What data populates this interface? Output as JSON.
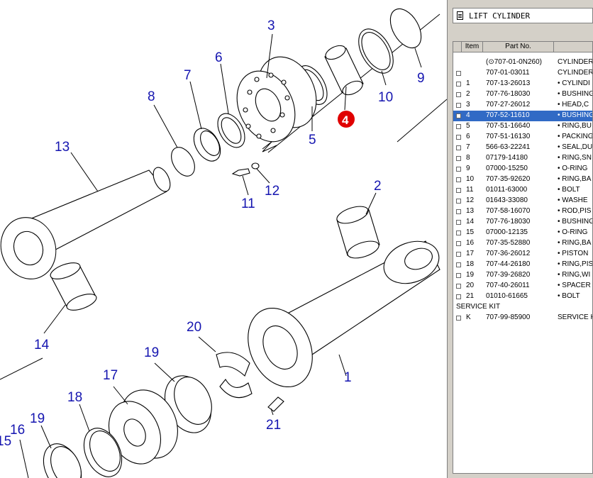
{
  "window": {
    "title": "LIFT CYLINDER"
  },
  "diagram": {
    "callouts": [
      "1",
      "2",
      "3",
      "4",
      "5",
      "6",
      "7",
      "8",
      "9",
      "10",
      "11",
      "12",
      "13",
      "14",
      "15",
      "16",
      "17",
      "18",
      "19",
      "19",
      "20",
      "21"
    ],
    "highlight_callout": "4",
    "colors": {
      "callout": "#1515b0",
      "highlight": "#e00000"
    }
  },
  "parts_list": {
    "columns": {
      "item": "Item",
      "part_no": "Part No."
    },
    "header_row": {
      "part_no": "(⊙707-01-0N260)",
      "name": "CYLINDER"
    },
    "rows": [
      {
        "item": "",
        "part_no": "707-01-03011",
        "name": "CYLINDER"
      },
      {
        "item": "1",
        "part_no": "707-13-26013",
        "name": "•  CYLINDI"
      },
      {
        "item": "2",
        "part_no": "707-76-18030",
        "name": "•  BUSHING"
      },
      {
        "item": "3",
        "part_no": "707-27-26012",
        "name": "•  HEAD,C"
      },
      {
        "item": "4",
        "part_no": "707-52-11610",
        "name": "•  BUSHING"
      },
      {
        "item": "5",
        "part_no": "707-51-16640",
        "name": "•  RING,BU"
      },
      {
        "item": "6",
        "part_no": "707-51-16130",
        "name": "•  PACKING"
      },
      {
        "item": "7",
        "part_no": "566-63-22241",
        "name": "•  SEAL,DU"
      },
      {
        "item": "8",
        "part_no": "07179-14180",
        "name": "•  RING,SN"
      },
      {
        "item": "9",
        "part_no": "07000-15250",
        "name": "•  O-RING"
      },
      {
        "item": "10",
        "part_no": "707-35-92620",
        "name": "•  RING,BA"
      },
      {
        "item": "11",
        "part_no": "01011-63000",
        "name": "•  BOLT"
      },
      {
        "item": "12",
        "part_no": "01643-33080",
        "name": "•  WASHE"
      },
      {
        "item": "13",
        "part_no": "707-58-16070",
        "name": "•  ROD,PIS"
      },
      {
        "item": "14",
        "part_no": "707-76-18030",
        "name": "•  BUSHING"
      },
      {
        "item": "15",
        "part_no": "07000-12135",
        "name": "•  O-RING"
      },
      {
        "item": "16",
        "part_no": "707-35-52880",
        "name": "•  RING,BA"
      },
      {
        "item": "17",
        "part_no": "707-36-26012",
        "name": "•  PISTON"
      },
      {
        "item": "18",
        "part_no": "707-44-26180",
        "name": "•  RING,PIS"
      },
      {
        "item": "19",
        "part_no": "707-39-26820",
        "name": "•  RING,WI"
      },
      {
        "item": "20",
        "part_no": "707-40-26011",
        "name": "•  SPACER"
      },
      {
        "item": "21",
        "part_no": "01010-61665",
        "name": "•  BOLT"
      }
    ],
    "section_label": "SERVICE KIT",
    "kit_row": {
      "item": "K",
      "part_no": "707-99-85900",
      "name": "SERVICE K"
    },
    "selected_item": "4",
    "colors": {
      "selection": "#316ac5"
    }
  }
}
